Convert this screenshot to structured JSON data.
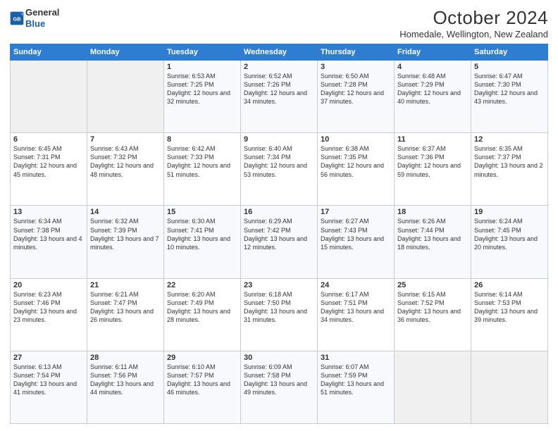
{
  "header": {
    "logo_line1": "General",
    "logo_line2": "Blue",
    "title": "October 2024",
    "subtitle": "Homedale, Wellington, New Zealand"
  },
  "days_of_week": [
    "Sunday",
    "Monday",
    "Tuesday",
    "Wednesday",
    "Thursday",
    "Friday",
    "Saturday"
  ],
  "weeks": [
    [
      {
        "day": "",
        "info": ""
      },
      {
        "day": "",
        "info": ""
      },
      {
        "day": "1",
        "info": "Sunrise: 6:53 AM\nSunset: 7:25 PM\nDaylight: 12 hours and 32 minutes."
      },
      {
        "day": "2",
        "info": "Sunrise: 6:52 AM\nSunset: 7:26 PM\nDaylight: 12 hours and 34 minutes."
      },
      {
        "day": "3",
        "info": "Sunrise: 6:50 AM\nSunset: 7:28 PM\nDaylight: 12 hours and 37 minutes."
      },
      {
        "day": "4",
        "info": "Sunrise: 6:48 AM\nSunset: 7:29 PM\nDaylight: 12 hours and 40 minutes."
      },
      {
        "day": "5",
        "info": "Sunrise: 6:47 AM\nSunset: 7:30 PM\nDaylight: 12 hours and 43 minutes."
      }
    ],
    [
      {
        "day": "6",
        "info": "Sunrise: 6:45 AM\nSunset: 7:31 PM\nDaylight: 12 hours and 45 minutes."
      },
      {
        "day": "7",
        "info": "Sunrise: 6:43 AM\nSunset: 7:32 PM\nDaylight: 12 hours and 48 minutes."
      },
      {
        "day": "8",
        "info": "Sunrise: 6:42 AM\nSunset: 7:33 PM\nDaylight: 12 hours and 51 minutes."
      },
      {
        "day": "9",
        "info": "Sunrise: 6:40 AM\nSunset: 7:34 PM\nDaylight: 12 hours and 53 minutes."
      },
      {
        "day": "10",
        "info": "Sunrise: 6:38 AM\nSunset: 7:35 PM\nDaylight: 12 hours and 56 minutes."
      },
      {
        "day": "11",
        "info": "Sunrise: 6:37 AM\nSunset: 7:36 PM\nDaylight: 12 hours and 59 minutes."
      },
      {
        "day": "12",
        "info": "Sunrise: 6:35 AM\nSunset: 7:37 PM\nDaylight: 13 hours and 2 minutes."
      }
    ],
    [
      {
        "day": "13",
        "info": "Sunrise: 6:34 AM\nSunset: 7:38 PM\nDaylight: 13 hours and 4 minutes."
      },
      {
        "day": "14",
        "info": "Sunrise: 6:32 AM\nSunset: 7:39 PM\nDaylight: 13 hours and 7 minutes."
      },
      {
        "day": "15",
        "info": "Sunrise: 6:30 AM\nSunset: 7:41 PM\nDaylight: 13 hours and 10 minutes."
      },
      {
        "day": "16",
        "info": "Sunrise: 6:29 AM\nSunset: 7:42 PM\nDaylight: 13 hours and 12 minutes."
      },
      {
        "day": "17",
        "info": "Sunrise: 6:27 AM\nSunset: 7:43 PM\nDaylight: 13 hours and 15 minutes."
      },
      {
        "day": "18",
        "info": "Sunrise: 6:26 AM\nSunset: 7:44 PM\nDaylight: 13 hours and 18 minutes."
      },
      {
        "day": "19",
        "info": "Sunrise: 6:24 AM\nSunset: 7:45 PM\nDaylight: 13 hours and 20 minutes."
      }
    ],
    [
      {
        "day": "20",
        "info": "Sunrise: 6:23 AM\nSunset: 7:46 PM\nDaylight: 13 hours and 23 minutes."
      },
      {
        "day": "21",
        "info": "Sunrise: 6:21 AM\nSunset: 7:47 PM\nDaylight: 13 hours and 26 minutes."
      },
      {
        "day": "22",
        "info": "Sunrise: 6:20 AM\nSunset: 7:49 PM\nDaylight: 13 hours and 28 minutes."
      },
      {
        "day": "23",
        "info": "Sunrise: 6:18 AM\nSunset: 7:50 PM\nDaylight: 13 hours and 31 minutes."
      },
      {
        "day": "24",
        "info": "Sunrise: 6:17 AM\nSunset: 7:51 PM\nDaylight: 13 hours and 34 minutes."
      },
      {
        "day": "25",
        "info": "Sunrise: 6:15 AM\nSunset: 7:52 PM\nDaylight: 13 hours and 36 minutes."
      },
      {
        "day": "26",
        "info": "Sunrise: 6:14 AM\nSunset: 7:53 PM\nDaylight: 13 hours and 39 minutes."
      }
    ],
    [
      {
        "day": "27",
        "info": "Sunrise: 6:13 AM\nSunset: 7:54 PM\nDaylight: 13 hours and 41 minutes."
      },
      {
        "day": "28",
        "info": "Sunrise: 6:11 AM\nSunset: 7:56 PM\nDaylight: 13 hours and 44 minutes."
      },
      {
        "day": "29",
        "info": "Sunrise: 6:10 AM\nSunset: 7:57 PM\nDaylight: 13 hours and 46 minutes."
      },
      {
        "day": "30",
        "info": "Sunrise: 6:09 AM\nSunset: 7:58 PM\nDaylight: 13 hours and 49 minutes."
      },
      {
        "day": "31",
        "info": "Sunrise: 6:07 AM\nSunset: 7:59 PM\nDaylight: 13 hours and 51 minutes."
      },
      {
        "day": "",
        "info": ""
      },
      {
        "day": "",
        "info": ""
      }
    ]
  ]
}
